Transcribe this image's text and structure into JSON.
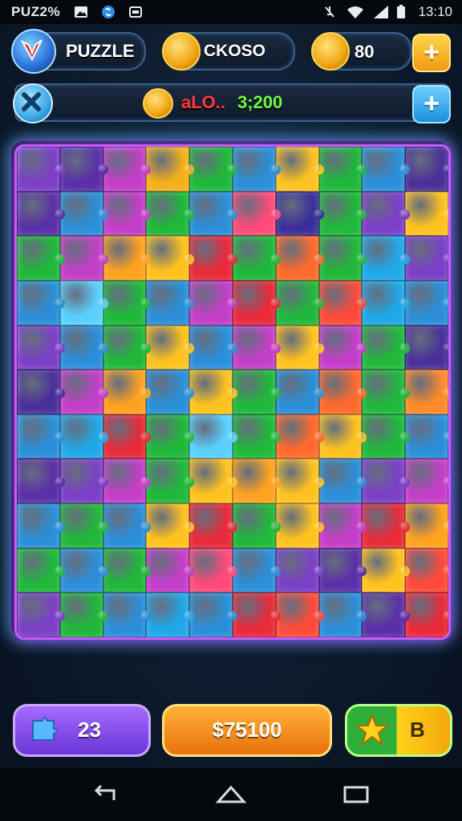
{
  "status_bar": {
    "left_text": "PUZ2%",
    "time": "13:10",
    "icons": [
      "photo-icon",
      "shazam-icon",
      "gamepad-icon",
      "mute-icon",
      "wifi-icon",
      "signal-icon",
      "battery-icon"
    ]
  },
  "header": {
    "title": "PUZZLE",
    "coins_label": "CKOSO",
    "gems_value": "80",
    "add_label": "+"
  },
  "score_bar": {
    "score_red": "aLO..",
    "score_green": "3;200",
    "add_label": "+"
  },
  "board": {
    "rows": 11,
    "cols": 10,
    "colors": [
      [
        "#7b3fc8",
        "#5a2fa8",
        "#c43ec8",
        "#f5b019",
        "#1fb83a",
        "#2a8fd8",
        "#ffc21f",
        "#1fb83a",
        "#2a8fd8",
        "#4a2f9a"
      ],
      [
        "#5a2fa8",
        "#2a8fd8",
        "#c43ec8",
        "#1fb83a",
        "#2a8fd8",
        "#ff4a7a",
        "#3a2f9a",
        "#1fb83a",
        "#7b3fc8",
        "#ffc21f"
      ],
      [
        "#1fb83a",
        "#c43ec8",
        "#ffa21f",
        "#ffc21f",
        "#e82a3a",
        "#1fb83a",
        "#ff6a2a",
        "#1fb83a",
        "#1fa8e8",
        "#7b3fc8"
      ],
      [
        "#2a8fd8",
        "#5ad0ff",
        "#1fb83a",
        "#2a8fd8",
        "#c43ec8",
        "#e82a3a",
        "#1fb83a",
        "#ff4a3a",
        "#1fa8e8",
        "#2a8fd8"
      ],
      [
        "#7b3fc8",
        "#2a8fd8",
        "#1fb83a",
        "#ffc21f",
        "#2a8fd8",
        "#c43ec8",
        "#ffc21f",
        "#c43ec8",
        "#1fb83a",
        "#4a2f9a"
      ],
      [
        "#4a2f9a",
        "#c43ec8",
        "#ffa21f",
        "#2a8fd8",
        "#ffc21f",
        "#1fb83a",
        "#2a8fd8",
        "#ff6a2a",
        "#1fb83a",
        "#ff8a2a"
      ],
      [
        "#2a8fd8",
        "#1fa8e8",
        "#e82a3a",
        "#1fb83a",
        "#5ad0ff",
        "#1fb83a",
        "#ff6a2a",
        "#ffc21f",
        "#1fb83a",
        "#2a8fd8"
      ],
      [
        "#5a2fa8",
        "#7b3fc8",
        "#c43ec8",
        "#1fb83a",
        "#ffc21f",
        "#ffa21f",
        "#ffc21f",
        "#2a8fd8",
        "#7b3fc8",
        "#c43ec8"
      ],
      [
        "#2a8fd8",
        "#1fb83a",
        "#2a8fd8",
        "#ffc21f",
        "#e82a3a",
        "#1fb83a",
        "#ffc21f",
        "#c43ec8",
        "#e82a3a",
        "#ffa21f"
      ],
      [
        "#1fb83a",
        "#2a8fd8",
        "#1fb83a",
        "#c43ec8",
        "#ff4a7a",
        "#2a8fd8",
        "#7b3fc8",
        "#5a2fa8",
        "#ffc21f",
        "#ff4a3a"
      ],
      [
        "#7b3fc8",
        "#1fb83a",
        "#2a8fd8",
        "#1fa8e8",
        "#2a8fd8",
        "#e82a3a",
        "#ff4a3a",
        "#2a8fd8",
        "#5a2fa8",
        "#e82a3a"
      ]
    ]
  },
  "footer": {
    "moves_value": "23",
    "money_value": "$75100",
    "stars_value": "B"
  },
  "colors": {
    "accent_purple": "#8a4fe8",
    "accent_orange": "#f59a1a",
    "accent_green": "#3fbf3a",
    "accent_yellow": "#ffd21a",
    "board_border_pink": "#c85cff",
    "board_border_cyan": "#3de7ff"
  }
}
